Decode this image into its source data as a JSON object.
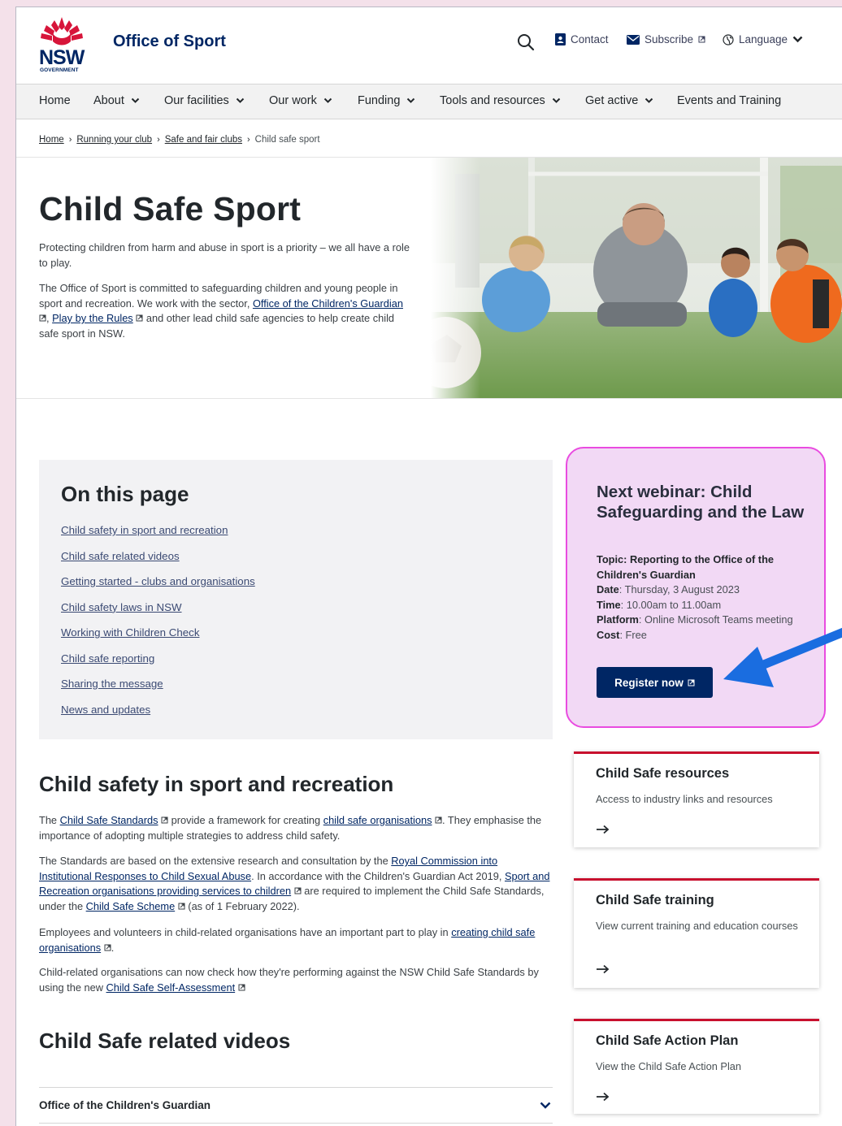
{
  "header": {
    "logo_text": "NSW",
    "logo_subtext": "GOVERNMENT",
    "site_title": "Office of Sport",
    "search_icon": "search-icon",
    "contact_label": "Contact",
    "subscribe_label": "Subscribe",
    "language_label": "Language"
  },
  "nav": {
    "items": [
      {
        "label": "Home",
        "dropdown": false
      },
      {
        "label": "About",
        "dropdown": true
      },
      {
        "label": "Our facilities",
        "dropdown": true
      },
      {
        "label": "Our work",
        "dropdown": true
      },
      {
        "label": "Funding",
        "dropdown": true
      },
      {
        "label": "Tools and resources",
        "dropdown": true
      },
      {
        "label": "Get active",
        "dropdown": true
      },
      {
        "label": "Events and Training",
        "dropdown": false
      }
    ]
  },
  "breadcrumb": {
    "items": [
      "Home",
      "Running your club",
      "Safe and fair clubs"
    ],
    "current": "Child safe sport"
  },
  "hero": {
    "title": "Child Safe Sport",
    "intro": "Protecting children from harm and abuse in sport is a priority – we all have a role to play.",
    "p2_a": "The Office of Sport is committed to safeguarding children and young people in sport and recreation. We work with the sector, ",
    "p2_link1": "Office of the Children's Guardian",
    "p2_b": ", ",
    "p2_link2": "Play by the Rules",
    "p2_c": " and other lead child safe agencies to help create child safe sport in NSW."
  },
  "on_this_page": {
    "title": "On this page",
    "links": [
      "Child safety in sport and recreation",
      "Child safe related videos",
      "Getting started - clubs and organisations",
      "Child safety laws in NSW",
      "Working with Children Check",
      "Child safe reporting",
      "Sharing the message",
      "News and updates"
    ]
  },
  "webinar": {
    "title": "Next webinar: Child Safeguarding and the Law",
    "topic_label": "Topic: Reporting to the Office of the Children's Guardian",
    "date_label": "Date",
    "date_value": ": Thursday, 3 August 2023",
    "time_label": "Time",
    "time_value": ": 10.00am to 11.00am",
    "platform_label": "Platform",
    "platform_value": ": Online Microsoft Teams meeting",
    "cost_label": "Cost",
    "cost_value": ": Free",
    "register_label": "Register now",
    "highlight_color": "#e94be0",
    "arrow_color": "#1a6de0"
  },
  "cards": [
    {
      "title": "Child Safe resources",
      "desc": "Access to industry links and resources"
    },
    {
      "title": "Child Safe training",
      "desc": "View current training and education courses"
    },
    {
      "title": "Child Safe Action Plan",
      "desc": "View the Child Safe Action Plan"
    }
  ],
  "section1": {
    "title": "Child safety in sport and recreation",
    "p1_a": "The ",
    "p1_link1": "Child Safe Standards",
    "p1_b": " provide a framework for creating ",
    "p1_link2": "child safe organisations",
    "p1_c": ". They emphasise the importance of adopting multiple strategies to address child safety.",
    "p2_a": "The Standards are based on the extensive research and consultation by the ",
    "p2_link1": "Royal Commission into Institutional Responses to Child Sexual Abuse",
    "p2_b": ". In accordance with the Children's Guardian Act 2019, ",
    "p2_link2": "Sport and Recreation organisations providing services to children",
    "p2_c": " are required to implement the Child Safe Standards, under the ",
    "p2_link3": "Child Safe Scheme",
    "p2_d": " (as of 1 February 2022).",
    "p3_a": "Employees and volunteers in child-related organisations have an important part to play in ",
    "p3_link": "creating child safe organisations",
    "p3_b": ".",
    "p4_a": "Child-related organisations can now check how they're performing against the NSW Child Safe Standards by using the new ",
    "p4_link": "Child Safe Self-Assessment"
  },
  "section2": {
    "title": "Child Safe related videos",
    "accordion_label": "Office of the Children's Guardian"
  }
}
